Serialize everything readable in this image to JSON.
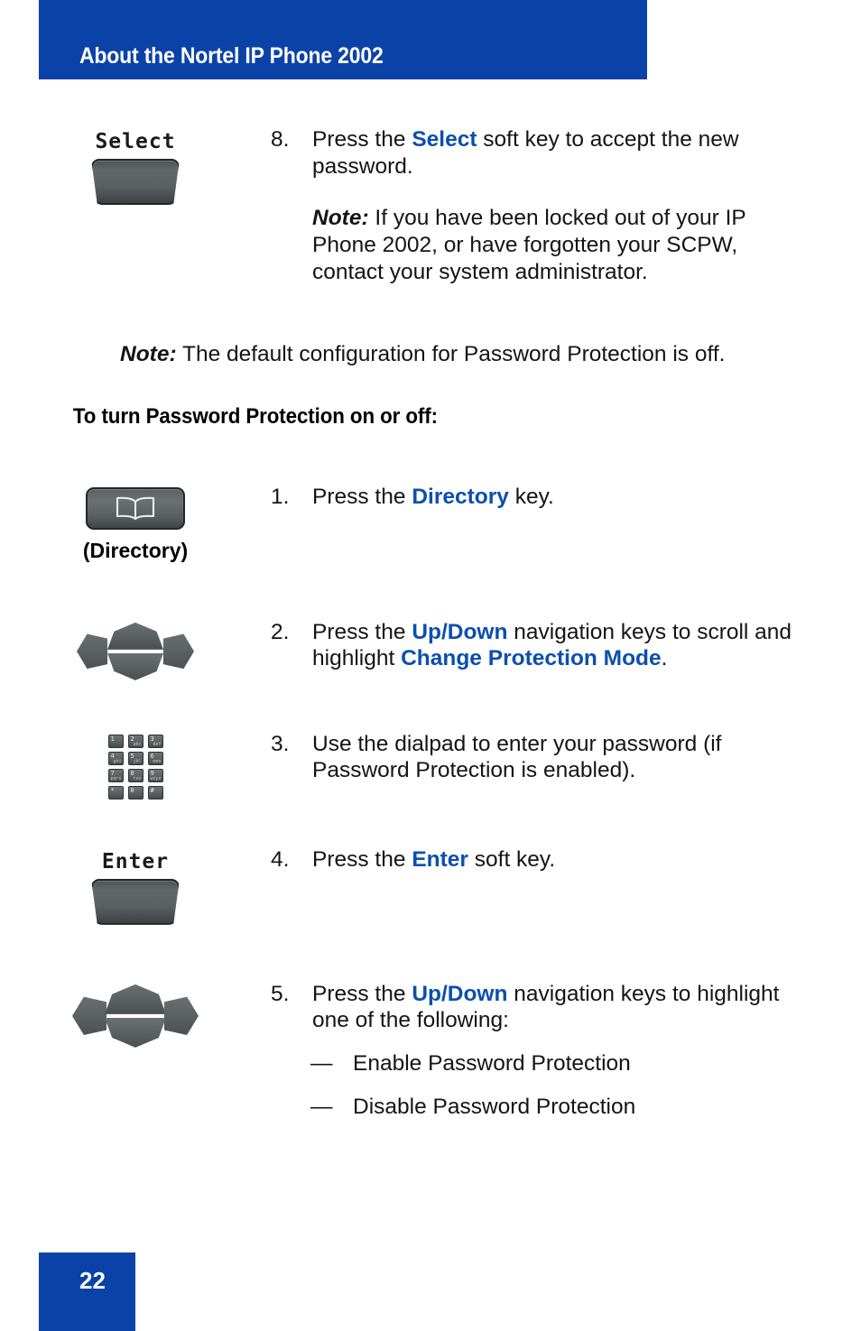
{
  "header": {
    "title": "About the Nortel IP Phone 2002",
    "bar_color": "#0A42A8"
  },
  "accent_color": "#0B4FAF",
  "steps": [
    {
      "number": "8.",
      "icon": "softkey-select",
      "icon_label": "Select",
      "text_before": "Press the ",
      "text_key": "Select",
      "text_after": " soft key to accept the new password.",
      "note_lead": "Note:",
      "note_text": " If you have been locked out of your IP Phone 2002, or have forgotten your SCPW, contact your system administrator."
    },
    {
      "number": "1.",
      "icon": "directory-key",
      "icon_label": "(Directory)",
      "text_before": "Press the ",
      "text_key": "Directory",
      "text_after": " key."
    },
    {
      "number": "2.",
      "icon": "navigation-keys",
      "text_before": "Press the ",
      "text_key": "Up/Down",
      "text_mid": " navigation keys to scroll and highlight ",
      "text_key2": "Change Protection Mode",
      "text_after": "."
    },
    {
      "number": "3.",
      "icon": "dialpad",
      "text_full": "Use the dialpad to enter your password (if Password Protection is enabled)."
    },
    {
      "number": "4.",
      "icon": "softkey-enter",
      "icon_label": "Enter",
      "text_before": "Press the ",
      "text_key": "Enter",
      "text_after": " soft key."
    },
    {
      "number": "5.",
      "icon": "navigation-keys",
      "text_before": "Press the ",
      "text_key": "Up/Down",
      "text_after": " navigation keys to highlight one of the following:",
      "bullets": [
        {
          "dash": "—",
          "label": "Enable Password Protection"
        },
        {
          "dash": "—",
          "label": "Disable Password Protection"
        }
      ]
    }
  ],
  "standalone_note": {
    "lead": "Note:",
    "text": " The default configuration for Password Protection is off."
  },
  "sub_heading": "To turn Password Protection on or off:",
  "dialpad_keys": [
    {
      "digit": "1",
      "letters": ""
    },
    {
      "digit": "2",
      "letters": "abc"
    },
    {
      "digit": "3",
      "letters": "def"
    },
    {
      "digit": "4",
      "letters": "ghi"
    },
    {
      "digit": "5",
      "letters": "jkl"
    },
    {
      "digit": "6",
      "letters": "mno"
    },
    {
      "digit": "7",
      "letters": "pqrs"
    },
    {
      "digit": "8",
      "letters": "tuv"
    },
    {
      "digit": "9",
      "letters": "wxyz"
    },
    {
      "digit": "*",
      "letters": ""
    },
    {
      "digit": "0",
      "letters": ""
    },
    {
      "digit": "#",
      "letters": ""
    }
  ],
  "footer": {
    "page_number": "22",
    "box_color": "#0A42A8"
  }
}
